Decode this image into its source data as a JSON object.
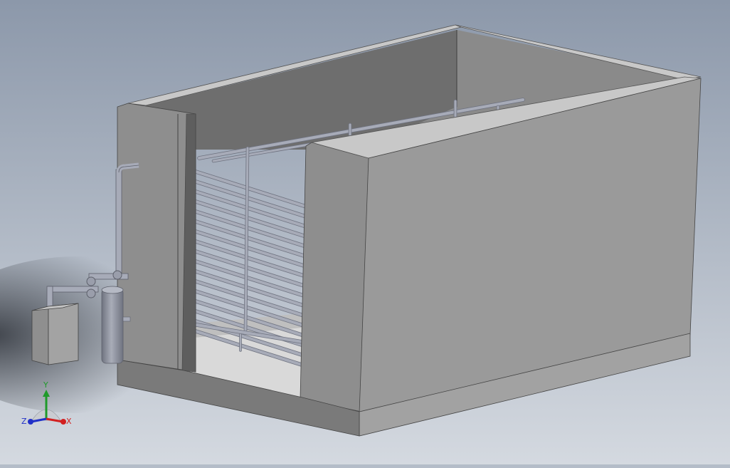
{
  "viewport": {
    "background_top": "#8c98aa",
    "background_bottom": "#d4d9e0",
    "shadow_color": "#2b2f36"
  },
  "model": {
    "wall_outer_color": "#9a9a9a",
    "wall_top_color": "#c8c8c8",
    "wall_inner_color": "#6e6e6e",
    "floor_color": "#d9d9d9",
    "pipe_color": "#a7abb8",
    "pipe_shade": "#6f7380"
  },
  "triad": {
    "x_label": "X",
    "y_label": "Y",
    "z_label": "Z",
    "x_color": "#d22020",
    "y_color": "#1f9a2a",
    "z_color": "#2030c8"
  }
}
